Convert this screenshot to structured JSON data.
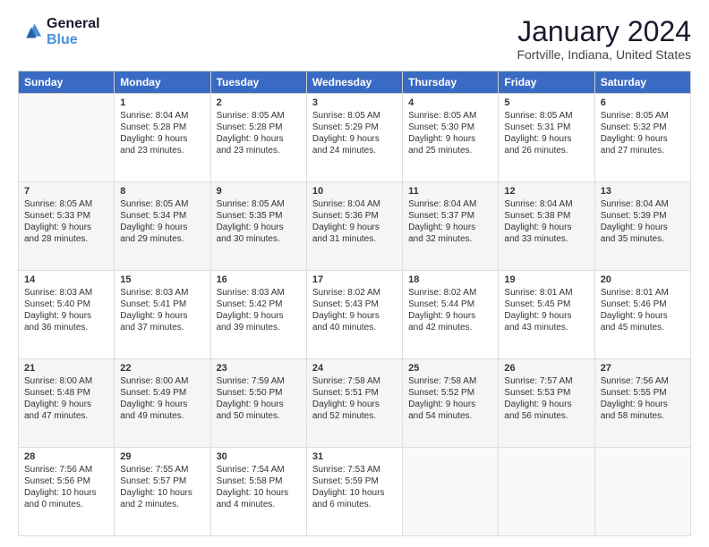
{
  "logo": {
    "line1": "General",
    "line2": "Blue"
  },
  "title": "January 2024",
  "location": "Fortville, Indiana, United States",
  "days_of_week": [
    "Sunday",
    "Monday",
    "Tuesday",
    "Wednesday",
    "Thursday",
    "Friday",
    "Saturday"
  ],
  "weeks": [
    [
      {
        "day": "",
        "content": ""
      },
      {
        "day": "1",
        "content": "Sunrise: 8:04 AM\nSunset: 5:28 PM\nDaylight: 9 hours\nand 23 minutes."
      },
      {
        "day": "2",
        "content": "Sunrise: 8:05 AM\nSunset: 5:28 PM\nDaylight: 9 hours\nand 23 minutes."
      },
      {
        "day": "3",
        "content": "Sunrise: 8:05 AM\nSunset: 5:29 PM\nDaylight: 9 hours\nand 24 minutes."
      },
      {
        "day": "4",
        "content": "Sunrise: 8:05 AM\nSunset: 5:30 PM\nDaylight: 9 hours\nand 25 minutes."
      },
      {
        "day": "5",
        "content": "Sunrise: 8:05 AM\nSunset: 5:31 PM\nDaylight: 9 hours\nand 26 minutes."
      },
      {
        "day": "6",
        "content": "Sunrise: 8:05 AM\nSunset: 5:32 PM\nDaylight: 9 hours\nand 27 minutes."
      }
    ],
    [
      {
        "day": "7",
        "content": "Sunrise: 8:05 AM\nSunset: 5:33 PM\nDaylight: 9 hours\nand 28 minutes."
      },
      {
        "day": "8",
        "content": "Sunrise: 8:05 AM\nSunset: 5:34 PM\nDaylight: 9 hours\nand 29 minutes."
      },
      {
        "day": "9",
        "content": "Sunrise: 8:05 AM\nSunset: 5:35 PM\nDaylight: 9 hours\nand 30 minutes."
      },
      {
        "day": "10",
        "content": "Sunrise: 8:04 AM\nSunset: 5:36 PM\nDaylight: 9 hours\nand 31 minutes."
      },
      {
        "day": "11",
        "content": "Sunrise: 8:04 AM\nSunset: 5:37 PM\nDaylight: 9 hours\nand 32 minutes."
      },
      {
        "day": "12",
        "content": "Sunrise: 8:04 AM\nSunset: 5:38 PM\nDaylight: 9 hours\nand 33 minutes."
      },
      {
        "day": "13",
        "content": "Sunrise: 8:04 AM\nSunset: 5:39 PM\nDaylight: 9 hours\nand 35 minutes."
      }
    ],
    [
      {
        "day": "14",
        "content": "Sunrise: 8:03 AM\nSunset: 5:40 PM\nDaylight: 9 hours\nand 36 minutes."
      },
      {
        "day": "15",
        "content": "Sunrise: 8:03 AM\nSunset: 5:41 PM\nDaylight: 9 hours\nand 37 minutes."
      },
      {
        "day": "16",
        "content": "Sunrise: 8:03 AM\nSunset: 5:42 PM\nDaylight: 9 hours\nand 39 minutes."
      },
      {
        "day": "17",
        "content": "Sunrise: 8:02 AM\nSunset: 5:43 PM\nDaylight: 9 hours\nand 40 minutes."
      },
      {
        "day": "18",
        "content": "Sunrise: 8:02 AM\nSunset: 5:44 PM\nDaylight: 9 hours\nand 42 minutes."
      },
      {
        "day": "19",
        "content": "Sunrise: 8:01 AM\nSunset: 5:45 PM\nDaylight: 9 hours\nand 43 minutes."
      },
      {
        "day": "20",
        "content": "Sunrise: 8:01 AM\nSunset: 5:46 PM\nDaylight: 9 hours\nand 45 minutes."
      }
    ],
    [
      {
        "day": "21",
        "content": "Sunrise: 8:00 AM\nSunset: 5:48 PM\nDaylight: 9 hours\nand 47 minutes."
      },
      {
        "day": "22",
        "content": "Sunrise: 8:00 AM\nSunset: 5:49 PM\nDaylight: 9 hours\nand 49 minutes."
      },
      {
        "day": "23",
        "content": "Sunrise: 7:59 AM\nSunset: 5:50 PM\nDaylight: 9 hours\nand 50 minutes."
      },
      {
        "day": "24",
        "content": "Sunrise: 7:58 AM\nSunset: 5:51 PM\nDaylight: 9 hours\nand 52 minutes."
      },
      {
        "day": "25",
        "content": "Sunrise: 7:58 AM\nSunset: 5:52 PM\nDaylight: 9 hours\nand 54 minutes."
      },
      {
        "day": "26",
        "content": "Sunrise: 7:57 AM\nSunset: 5:53 PM\nDaylight: 9 hours\nand 56 minutes."
      },
      {
        "day": "27",
        "content": "Sunrise: 7:56 AM\nSunset: 5:55 PM\nDaylight: 9 hours\nand 58 minutes."
      }
    ],
    [
      {
        "day": "28",
        "content": "Sunrise: 7:56 AM\nSunset: 5:56 PM\nDaylight: 10 hours\nand 0 minutes."
      },
      {
        "day": "29",
        "content": "Sunrise: 7:55 AM\nSunset: 5:57 PM\nDaylight: 10 hours\nand 2 minutes."
      },
      {
        "day": "30",
        "content": "Sunrise: 7:54 AM\nSunset: 5:58 PM\nDaylight: 10 hours\nand 4 minutes."
      },
      {
        "day": "31",
        "content": "Sunrise: 7:53 AM\nSunset: 5:59 PM\nDaylight: 10 hours\nand 6 minutes."
      },
      {
        "day": "",
        "content": ""
      },
      {
        "day": "",
        "content": ""
      },
      {
        "day": "",
        "content": ""
      }
    ]
  ]
}
